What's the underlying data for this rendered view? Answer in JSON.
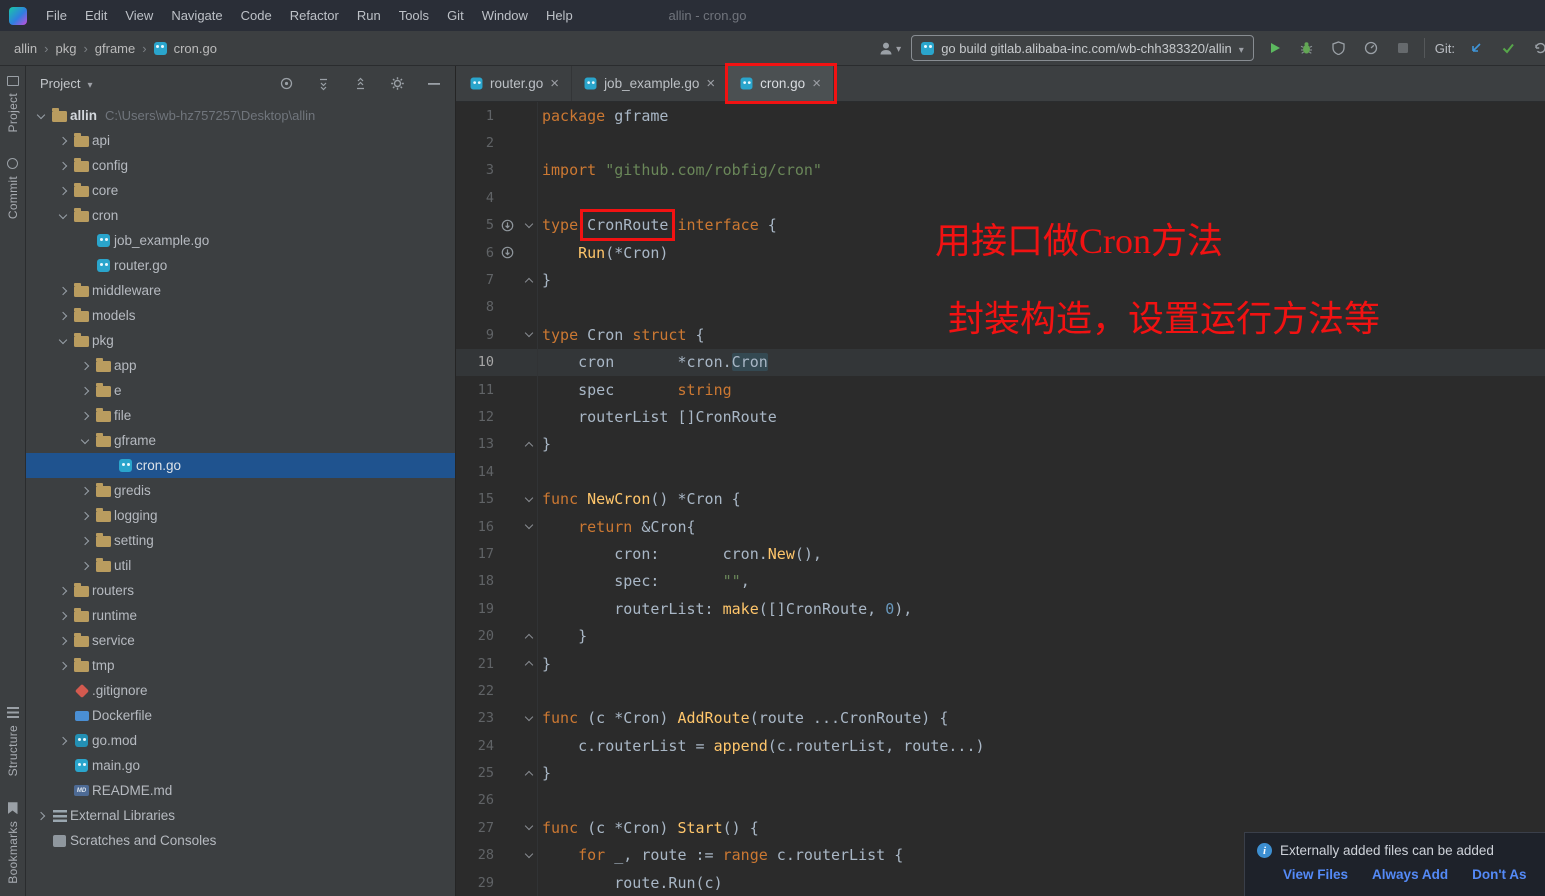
{
  "window": {
    "title": "allin - cron.go"
  },
  "menu": [
    "File",
    "Edit",
    "View",
    "Navigate",
    "Code",
    "Refactor",
    "Run",
    "Tools",
    "Git",
    "Window",
    "Help"
  ],
  "breadcrumbs": [
    "allin",
    "pkg",
    "gframe",
    "cron.go"
  ],
  "run_config": {
    "label": "go build gitlab.alibaba-inc.com/wb-chh383320/allin"
  },
  "git": {
    "label": "Git:"
  },
  "tool_windows": {
    "left_top": [
      "Project",
      "Commit"
    ],
    "left_bottom": [
      "Structure",
      "Bookmarks"
    ]
  },
  "project_panel": {
    "header": "Project",
    "tree": [
      {
        "level": 0,
        "chev": "open",
        "icon": "folder",
        "label": "allin",
        "sub": "C:\\Users\\wb-hz757257\\Desktop\\allin",
        "bold": true
      },
      {
        "level": 1,
        "chev": "closed",
        "icon": "folder",
        "label": "api"
      },
      {
        "level": 1,
        "chev": "closed",
        "icon": "folder",
        "label": "config"
      },
      {
        "level": 1,
        "chev": "closed",
        "icon": "folder",
        "label": "core"
      },
      {
        "level": 1,
        "chev": "open",
        "icon": "folder",
        "label": "cron"
      },
      {
        "level": 2,
        "chev": null,
        "icon": "go",
        "label": "job_example.go"
      },
      {
        "level": 2,
        "chev": null,
        "icon": "go",
        "label": "router.go"
      },
      {
        "level": 1,
        "chev": "closed",
        "icon": "folder",
        "label": "middleware"
      },
      {
        "level": 1,
        "chev": "closed",
        "icon": "folder",
        "label": "models"
      },
      {
        "level": 1,
        "chev": "open",
        "icon": "folder",
        "label": "pkg"
      },
      {
        "level": 2,
        "chev": "closed",
        "icon": "folder",
        "label": "app"
      },
      {
        "level": 2,
        "chev": "closed",
        "icon": "folder",
        "label": "e"
      },
      {
        "level": 2,
        "chev": "closed",
        "icon": "folder",
        "label": "file"
      },
      {
        "level": 2,
        "chev": "open",
        "icon": "folder",
        "label": "gframe"
      },
      {
        "level": 3,
        "chev": null,
        "icon": "go",
        "label": "cron.go",
        "selected": true
      },
      {
        "level": 2,
        "chev": "closed",
        "icon": "folder",
        "label": "gredis"
      },
      {
        "level": 2,
        "chev": "closed",
        "icon": "folder",
        "label": "logging"
      },
      {
        "level": 2,
        "chev": "closed",
        "icon": "folder",
        "label": "setting"
      },
      {
        "level": 2,
        "chev": "closed",
        "icon": "folder",
        "label": "util"
      },
      {
        "level": 1,
        "chev": "closed",
        "icon": "folder",
        "label": "routers"
      },
      {
        "level": 1,
        "chev": "closed",
        "icon": "folder",
        "label": "runtime"
      },
      {
        "level": 1,
        "chev": "closed",
        "icon": "folder",
        "label": "service"
      },
      {
        "level": 1,
        "chev": "closed",
        "icon": "folder",
        "label": "tmp"
      },
      {
        "level": 1,
        "chev": null,
        "icon": "gitignore",
        "label": ".gitignore"
      },
      {
        "level": 1,
        "chev": null,
        "icon": "docker",
        "label": "Dockerfile"
      },
      {
        "level": 1,
        "chev": "closed",
        "icon": "gomod",
        "label": "go.mod"
      },
      {
        "level": 1,
        "chev": null,
        "icon": "go",
        "label": "main.go"
      },
      {
        "level": 1,
        "chev": null,
        "icon": "md",
        "label": "README.md"
      },
      {
        "level": 0,
        "chev": "closed",
        "icon": "lib",
        "label": "External Libraries"
      },
      {
        "level": 0,
        "chev": null,
        "icon": "scratch",
        "label": "Scratches and Consoles"
      }
    ]
  },
  "tabs": [
    {
      "label": "router.go",
      "active": false
    },
    {
      "label": "job_example.go",
      "active": false
    },
    {
      "label": "cron.go",
      "active": true
    }
  ],
  "editor": {
    "current_line": 10,
    "impl_lines": [
      5,
      6
    ],
    "fold_open": [
      5,
      9,
      15,
      16,
      23,
      27,
      28
    ],
    "fold_end": [
      7,
      13,
      20,
      21,
      25
    ],
    "lines": [
      {
        "num": 1,
        "tokens": [
          [
            "k",
            "package"
          ],
          [
            "d",
            " gframe"
          ]
        ]
      },
      {
        "num": 2,
        "tokens": []
      },
      {
        "num": 3,
        "tokens": [
          [
            "k",
            "import "
          ],
          [
            "s",
            "\"github.com/robfig/cron\""
          ]
        ]
      },
      {
        "num": 4,
        "tokens": []
      },
      {
        "num": 5,
        "tokens": [
          [
            "k",
            "type "
          ],
          [
            "drb",
            "CronRoute"
          ],
          [
            "d",
            " "
          ],
          [
            "k",
            "interface"
          ],
          [
            "d",
            " {"
          ]
        ]
      },
      {
        "num": 6,
        "tokens": [
          [
            "d",
            "    "
          ],
          [
            "f",
            "Run"
          ],
          [
            "d",
            "(*Cron)"
          ]
        ]
      },
      {
        "num": 7,
        "tokens": [
          [
            "d",
            "}"
          ]
        ]
      },
      {
        "num": 8,
        "tokens": []
      },
      {
        "num": 9,
        "tokens": [
          [
            "k",
            "type "
          ],
          [
            "d",
            "Cron "
          ],
          [
            "k",
            "struct"
          ],
          [
            "d",
            " {"
          ]
        ]
      },
      {
        "num": 10,
        "tokens": [
          [
            "d",
            "    cron       *cron."
          ],
          [
            "hl",
            "Cron"
          ]
        ]
      },
      {
        "num": 11,
        "tokens": [
          [
            "d",
            "    spec       "
          ],
          [
            "k",
            "string"
          ]
        ]
      },
      {
        "num": 12,
        "tokens": [
          [
            "d",
            "    routerList []CronRoute"
          ]
        ]
      },
      {
        "num": 13,
        "tokens": [
          [
            "d",
            "}"
          ]
        ]
      },
      {
        "num": 14,
        "tokens": []
      },
      {
        "num": 15,
        "tokens": [
          [
            "k",
            "func "
          ],
          [
            "f",
            "NewCron"
          ],
          [
            "d",
            "() *Cron {"
          ]
        ]
      },
      {
        "num": 16,
        "tokens": [
          [
            "d",
            "    "
          ],
          [
            "k",
            "return "
          ],
          [
            "d",
            "&Cron{"
          ]
        ]
      },
      {
        "num": 17,
        "tokens": [
          [
            "d",
            "        cron:       cron."
          ],
          [
            "f",
            "New"
          ],
          [
            "d",
            "(),"
          ]
        ]
      },
      {
        "num": 18,
        "tokens": [
          [
            "d",
            "        spec:       "
          ],
          [
            "s",
            "\"\""
          ],
          [
            "d",
            ","
          ]
        ]
      },
      {
        "num": 19,
        "tokens": [
          [
            "d",
            "        routerList: "
          ],
          [
            "f",
            "make"
          ],
          [
            "d",
            "([]CronRoute, "
          ],
          [
            "n",
            "0"
          ],
          [
            "d",
            "),"
          ]
        ]
      },
      {
        "num": 20,
        "tokens": [
          [
            "d",
            "    }"
          ]
        ]
      },
      {
        "num": 21,
        "tokens": [
          [
            "d",
            "}"
          ]
        ]
      },
      {
        "num": 22,
        "tokens": []
      },
      {
        "num": 23,
        "tokens": [
          [
            "k",
            "func "
          ],
          [
            "d",
            "(c *Cron) "
          ],
          [
            "f",
            "AddRoute"
          ],
          [
            "d",
            "(route ...CronRoute) {"
          ]
        ]
      },
      {
        "num": 24,
        "tokens": [
          [
            "d",
            "    c.routerList = "
          ],
          [
            "f",
            "append"
          ],
          [
            "d",
            "(c.routerList, route...)"
          ]
        ]
      },
      {
        "num": 25,
        "tokens": [
          [
            "d",
            "}"
          ]
        ]
      },
      {
        "num": 26,
        "tokens": []
      },
      {
        "num": 27,
        "tokens": [
          [
            "k",
            "func "
          ],
          [
            "d",
            "(c *Cron) "
          ],
          [
            "f",
            "Start"
          ],
          [
            "d",
            "() {"
          ]
        ]
      },
      {
        "num": 28,
        "tokens": [
          [
            "d",
            "    "
          ],
          [
            "k",
            "for"
          ],
          [
            "d",
            " _, route := "
          ],
          [
            "k",
            "range"
          ],
          [
            "d",
            " c.routerList {"
          ]
        ]
      },
      {
        "num": 29,
        "tokens": [
          [
            "d",
            "        route.Run(c)"
          ]
        ]
      }
    ]
  },
  "annotations": {
    "note1": "用接口做Cron方法",
    "note2": "封装构造，设置运行方法等"
  },
  "notification": {
    "message": "Externally added files can be added",
    "actions": [
      "View Files",
      "Always Add",
      "Don't As"
    ]
  },
  "colors": {
    "annotation_red": "#f21212",
    "selection_blue": "#1f538f",
    "link_blue": "#548af7",
    "keyword_orange": "#cc7832",
    "string_green": "#6a8759",
    "function_yellow": "#ffc66b"
  }
}
